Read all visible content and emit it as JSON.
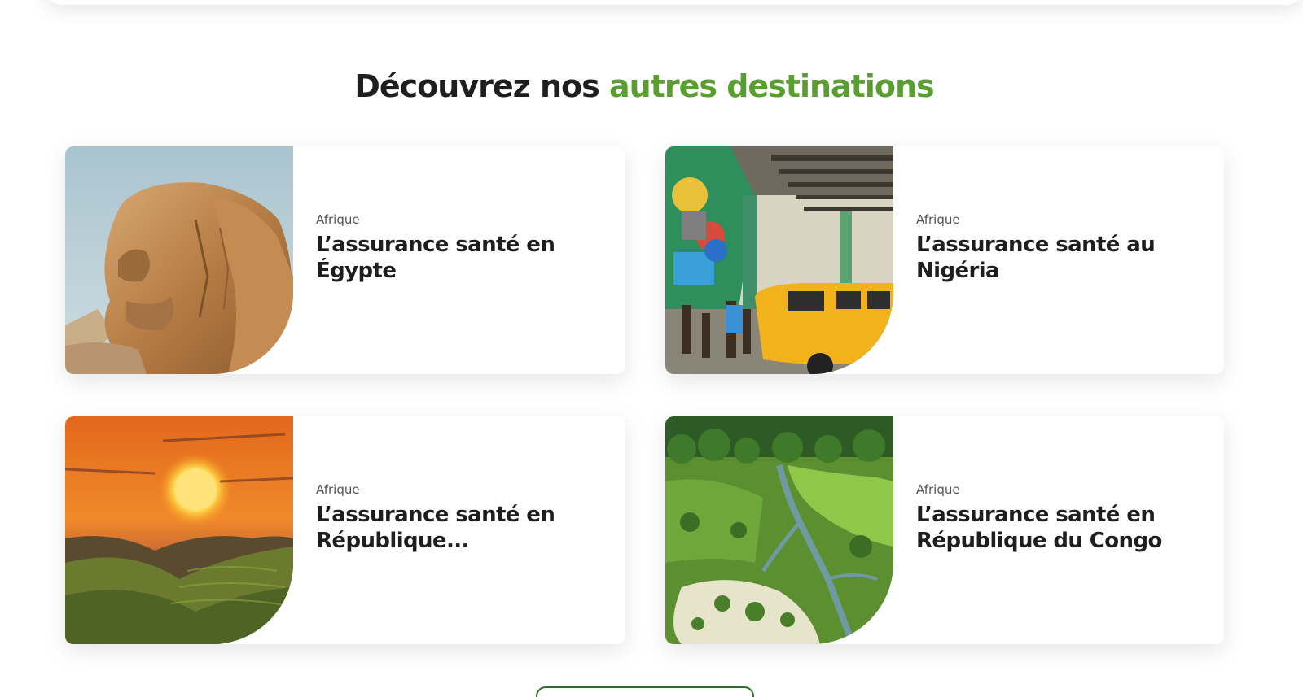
{
  "section": {
    "title_part1": "Découvrez nos",
    "title_part2": "autres destinations"
  },
  "colors": {
    "accent": "#5a9e32",
    "text": "#1e1e1e",
    "button_border": "#2f6b2a"
  },
  "cards": [
    {
      "category": "Afrique",
      "title": "L’assurance santé en Égypte",
      "image": "sphinx-photo"
    },
    {
      "category": "Afrique",
      "title": "L’assurance santé au Nigéria",
      "image": "lagos-street-photo"
    },
    {
      "category": "Afrique",
      "title": "L’assurance santé en République...",
      "image": "sunset-hills-photo"
    },
    {
      "category": "Afrique",
      "title": "L’assurance santé en République du Congo",
      "image": "rainforest-river-photo"
    }
  ]
}
